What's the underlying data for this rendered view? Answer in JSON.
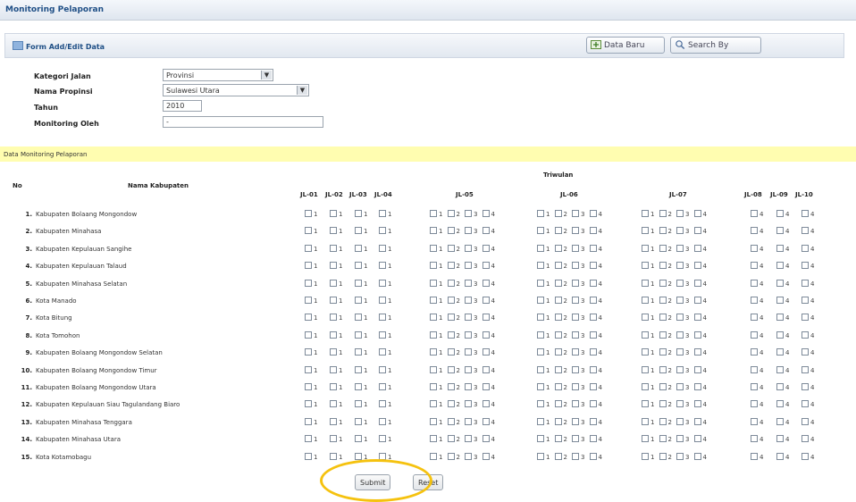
{
  "app": {
    "title": "Monitoring Pelaporan"
  },
  "form": {
    "title": "Form Add/Edit Data",
    "data_baru_label": "Data Baru",
    "search_label": "Search By",
    "fields": {
      "kategori_label": "Kategori Jalan",
      "kategori_value": "Provinsi",
      "propinsi_label": "Nama Propinsi",
      "propinsi_value": "Sulawesi Utara",
      "tahun_label": "Tahun",
      "tahun_value": "2010",
      "monitoring_label": "Monitoring Oleh",
      "monitoring_value": "-"
    }
  },
  "section": {
    "title": "Data Monitoring Pelaporan"
  },
  "table": {
    "col_no": "No",
    "col_nama": "Nama Kabupaten",
    "col_triwulan": "Triwulan",
    "jl_headers": [
      "JL-01",
      "JL-02",
      "JL-03",
      "JL-04",
      "JL-05",
      "JL-06",
      "JL-07",
      "JL-08",
      "JL-09",
      "JL-10"
    ],
    "rows": [
      {
        "no": "1.",
        "name": "Kabupaten Bolaang Mongondow"
      },
      {
        "no": "2.",
        "name": "Kabupaten Minahasa"
      },
      {
        "no": "3.",
        "name": "Kabupaten Kepulauan Sangihe"
      },
      {
        "no": "4.",
        "name": "Kabupaten Kepulauan Talaud"
      },
      {
        "no": "5.",
        "name": "Kabupaten Minahasa Selatan"
      },
      {
        "no": "6.",
        "name": "Kota Manado"
      },
      {
        "no": "7.",
        "name": "Kota Bitung"
      },
      {
        "no": "8.",
        "name": "Kota Tomohon"
      },
      {
        "no": "9.",
        "name": "Kabupaten Bolaang Mongondow Selatan"
      },
      {
        "no": "10.",
        "name": "Kabupaten Bolaang Mongondow Timur"
      },
      {
        "no": "11.",
        "name": "Kabupaten Bolaang Mongondow Utara"
      },
      {
        "no": "12.",
        "name": "Kabupaten Kepulauan Siau Tagulandang Biaro"
      },
      {
        "no": "13.",
        "name": "Kabupaten Minahasa Tenggara"
      },
      {
        "no": "14.",
        "name": "Kabupaten Minahasa Utara"
      },
      {
        "no": "15.",
        "name": "Kota Kotamobagu"
      }
    ]
  },
  "buttons": {
    "submit": "Submit",
    "reset": "Reset"
  },
  "colors": {
    "header_text": "#1f4f86",
    "highlight_bar": "#fffdb0",
    "annotation_circle": "#f5c20f"
  },
  "icons": [
    "new-data-icon",
    "search-icon",
    "form-icon",
    "dropdown-arrow-icon"
  ]
}
